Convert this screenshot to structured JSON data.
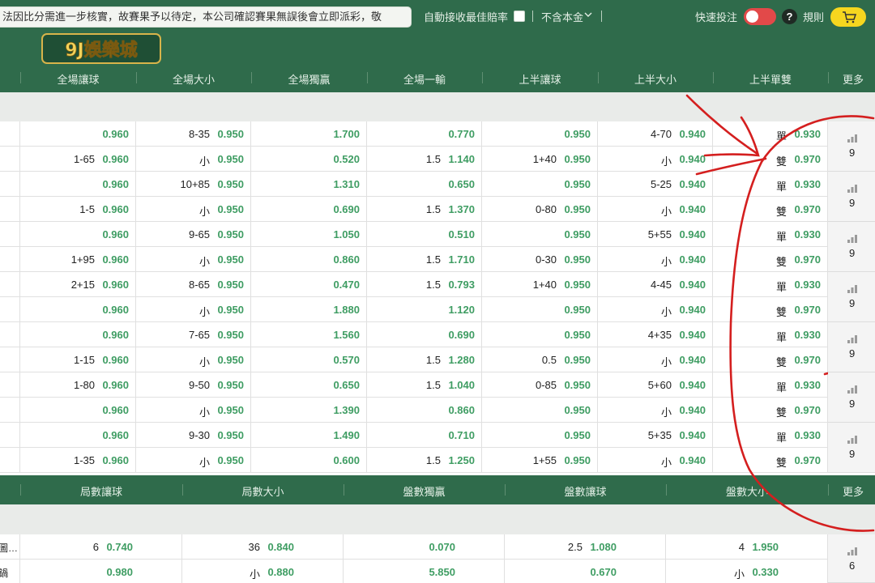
{
  "topbar": {
    "marquee": "法因比分需進一步核實，故賽果予以待定，本公司確認賽果無誤後會立即派彩，敬",
    "auto_accept": "自動接收最佳賠率",
    "principal": "不含本金",
    "quick_bet": "快速投注",
    "rules": "規則",
    "help": "?"
  },
  "logo": {
    "text": "9J娛樂城"
  },
  "columns1": [
    "全場讓球",
    "全場大小",
    "全場獨贏",
    "全場一輸",
    "上半讓球",
    "上半大小",
    "上半單雙",
    "更多"
  ],
  "rows1": [
    [
      [
        "",
        "0.960"
      ],
      [
        "8-35",
        "0.950"
      ],
      [
        "",
        "1.700"
      ],
      [
        "",
        "0.770"
      ],
      [
        "",
        "0.950"
      ],
      [
        "4-70",
        "0.940"
      ],
      [
        "單",
        "0.930"
      ]
    ],
    [
      [
        "1-65",
        "0.960"
      ],
      [
        "小",
        "0.950"
      ],
      [
        "",
        "0.520"
      ],
      [
        "1.5",
        "1.140"
      ],
      [
        "1+40",
        "0.950"
      ],
      [
        "小",
        "0.940"
      ],
      [
        "雙",
        "0.970"
      ]
    ],
    [
      [
        "",
        "0.960"
      ],
      [
        "10+85",
        "0.950"
      ],
      [
        "",
        "1.310"
      ],
      [
        "",
        "0.650"
      ],
      [
        "",
        "0.950"
      ],
      [
        "5-25",
        "0.940"
      ],
      [
        "單",
        "0.930"
      ]
    ],
    [
      [
        "1-5",
        "0.960"
      ],
      [
        "小",
        "0.950"
      ],
      [
        "",
        "0.690"
      ],
      [
        "1.5",
        "1.370"
      ],
      [
        "0-80",
        "0.950"
      ],
      [
        "小",
        "0.940"
      ],
      [
        "雙",
        "0.970"
      ]
    ],
    [
      [
        "",
        "0.960"
      ],
      [
        "9-65",
        "0.950"
      ],
      [
        "",
        "1.050"
      ],
      [
        "",
        "0.510"
      ],
      [
        "",
        "0.950"
      ],
      [
        "5+55",
        "0.940"
      ],
      [
        "單",
        "0.930"
      ]
    ],
    [
      [
        "1+95",
        "0.960"
      ],
      [
        "小",
        "0.950"
      ],
      [
        "",
        "0.860"
      ],
      [
        "1.5",
        "1.710"
      ],
      [
        "0-30",
        "0.950"
      ],
      [
        "小",
        "0.940"
      ],
      [
        "雙",
        "0.970"
      ]
    ],
    [
      [
        "2+15",
        "0.960"
      ],
      [
        "8-65",
        "0.950"
      ],
      [
        "",
        "0.470"
      ],
      [
        "1.5",
        "0.793"
      ],
      [
        "1+40",
        "0.950"
      ],
      [
        "4-45",
        "0.940"
      ],
      [
        "單",
        "0.930"
      ]
    ],
    [
      [
        "",
        "0.960"
      ],
      [
        "小",
        "0.950"
      ],
      [
        "",
        "1.880"
      ],
      [
        "",
        "1.120"
      ],
      [
        "",
        "0.950"
      ],
      [
        "小",
        "0.940"
      ],
      [
        "雙",
        "0.970"
      ]
    ],
    [
      [
        "",
        "0.960"
      ],
      [
        "7-65",
        "0.950"
      ],
      [
        "",
        "1.560"
      ],
      [
        "",
        "0.690"
      ],
      [
        "",
        "0.950"
      ],
      [
        "4+35",
        "0.940"
      ],
      [
        "單",
        "0.930"
      ]
    ],
    [
      [
        "1-15",
        "0.960"
      ],
      [
        "小",
        "0.950"
      ],
      [
        "",
        "0.570"
      ],
      [
        "1.5",
        "1.280"
      ],
      [
        "0.5",
        "0.950"
      ],
      [
        "小",
        "0.940"
      ],
      [
        "雙",
        "0.970"
      ]
    ],
    [
      [
        "1-80",
        "0.960"
      ],
      [
        "9-50",
        "0.950"
      ],
      [
        "",
        "0.650"
      ],
      [
        "1.5",
        "1.040"
      ],
      [
        "0-85",
        "0.950"
      ],
      [
        "5+60",
        "0.940"
      ],
      [
        "單",
        "0.930"
      ]
    ],
    [
      [
        "",
        "0.960"
      ],
      [
        "小",
        "0.950"
      ],
      [
        "",
        "1.390"
      ],
      [
        "",
        "0.860"
      ],
      [
        "",
        "0.950"
      ],
      [
        "小",
        "0.940"
      ],
      [
        "雙",
        "0.970"
      ]
    ],
    [
      [
        "",
        "0.960"
      ],
      [
        "9-30",
        "0.950"
      ],
      [
        "",
        "1.490"
      ],
      [
        "",
        "0.710"
      ],
      [
        "",
        "0.950"
      ],
      [
        "5+35",
        "0.940"
      ],
      [
        "單",
        "0.930"
      ]
    ],
    [
      [
        "1-35",
        "0.960"
      ],
      [
        "小",
        "0.950"
      ],
      [
        "",
        "0.600"
      ],
      [
        "1.5",
        "1.250"
      ],
      [
        "1+55",
        "0.950"
      ],
      [
        "小",
        "0.940"
      ],
      [
        "雙",
        "0.970"
      ]
    ]
  ],
  "more1": [
    "9",
    "9",
    "9",
    "9",
    "9",
    "9",
    "9"
  ],
  "columns2": [
    "局數讓球",
    "局數大小",
    "盤數獨贏",
    "盤數讓球",
    "盤數大小",
    "更多"
  ],
  "rows2": [
    [
      [
        "6",
        "0.740"
      ],
      [
        "36",
        "0.840"
      ],
      [
        "",
        "0.070"
      ],
      [
        "2.5",
        "1.080"
      ],
      [
        "4",
        "1.950"
      ]
    ],
    [
      [
        "",
        "0.980"
      ],
      [
        "小",
        "0.880"
      ],
      [
        "",
        "5.850"
      ],
      [
        "",
        "0.670"
      ],
      [
        "小",
        "0.330"
      ]
    ]
  ],
  "rows2_left": [
    "圖…",
    "鍋"
  ],
  "more2": [
    "6"
  ]
}
